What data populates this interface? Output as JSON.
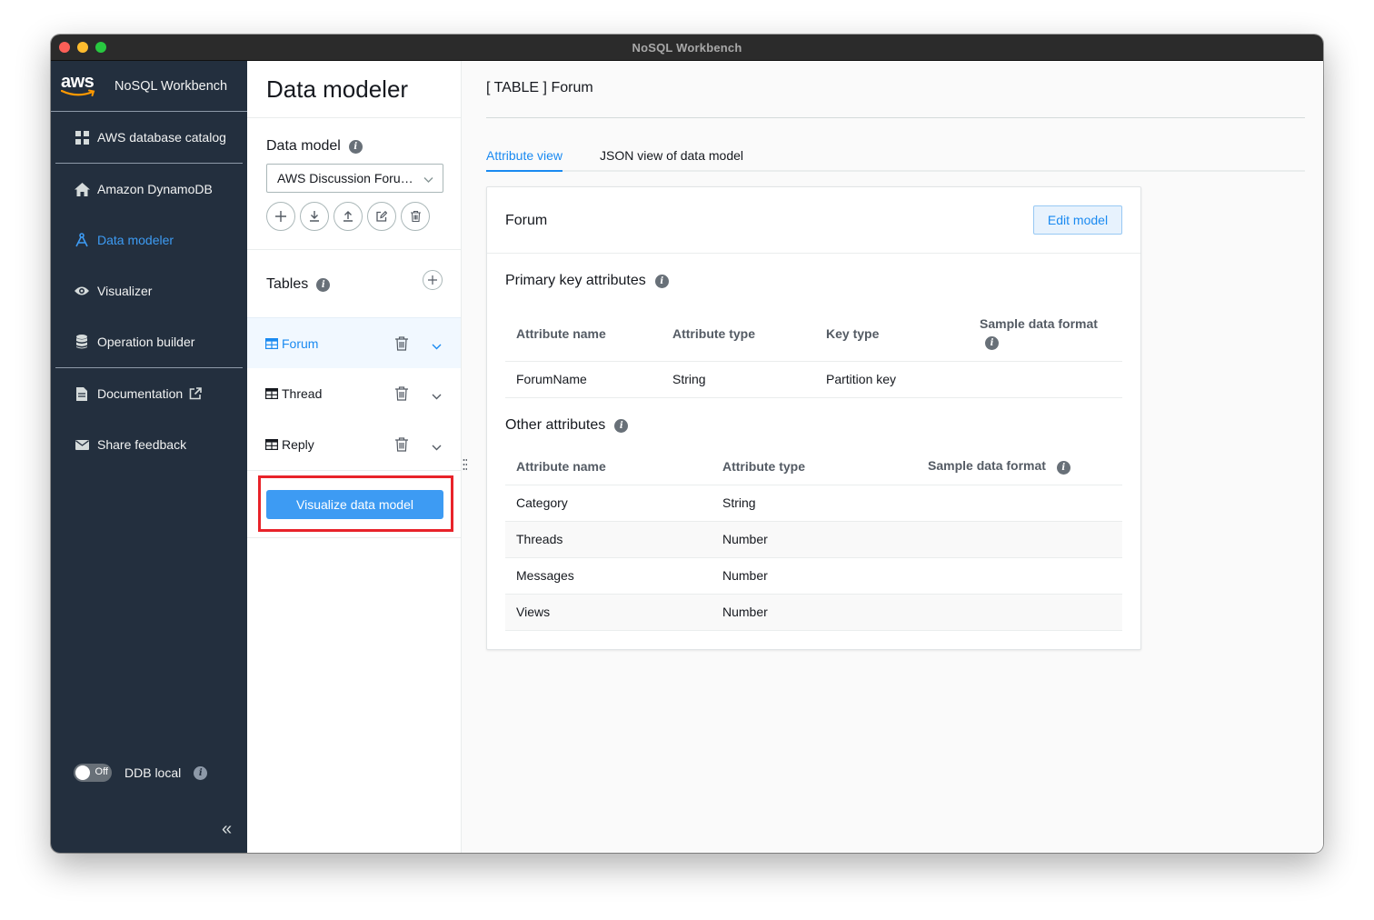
{
  "window": {
    "title": "NoSQL Workbench"
  },
  "sidebar": {
    "brand": {
      "logo_text": "aws",
      "name": "NoSQL Workbench"
    },
    "items": [
      {
        "label": "AWS database catalog",
        "icon": "grid-icon"
      },
      {
        "label": "Amazon DynamoDB",
        "icon": "home-icon"
      },
      {
        "label": "Data modeler",
        "icon": "modeler-icon",
        "active": true
      },
      {
        "label": "Visualizer",
        "icon": "eye-icon"
      },
      {
        "label": "Operation builder",
        "icon": "database-icon"
      },
      {
        "label": "Documentation",
        "icon": "document-icon"
      },
      {
        "label": "Share feedback",
        "icon": "mail-icon"
      }
    ],
    "ddb_local": {
      "label": "DDB local",
      "toggle_text": "Off"
    },
    "collapse": "«"
  },
  "panel": {
    "title": "Data modeler",
    "data_model_label": "Data model",
    "selected_model": "AWS Discussion Forum Data Model",
    "tables_label": "Tables",
    "tables": [
      {
        "name": "Forum",
        "active": true
      },
      {
        "name": "Thread"
      },
      {
        "name": "Reply"
      }
    ],
    "visualize_button": "Visualize data model"
  },
  "main": {
    "heading": "[ TABLE ] Forum",
    "tabs": [
      {
        "label": "Attribute view",
        "active": true
      },
      {
        "label": "JSON view of data model"
      }
    ],
    "card": {
      "name": "Forum",
      "edit_button": "Edit model",
      "primary": {
        "title": "Primary key attributes",
        "headers": [
          "Attribute name",
          "Attribute type",
          "Key type",
          "Sample data format"
        ],
        "rows": [
          [
            "ForumName",
            "String",
            "Partition key",
            ""
          ]
        ]
      },
      "other": {
        "title": "Other attributes",
        "headers": [
          "Attribute name",
          "Attribute type",
          "Sample data format"
        ],
        "rows": [
          [
            "Category",
            "String",
            ""
          ],
          [
            "Threads",
            "Number",
            ""
          ],
          [
            "Messages",
            "Number",
            ""
          ],
          [
            "Views",
            "Number",
            ""
          ]
        ]
      }
    }
  },
  "colors": {
    "sidebar_bg": "#232f3e",
    "accent": "#1a8af1",
    "highlight": "#e8232a"
  }
}
